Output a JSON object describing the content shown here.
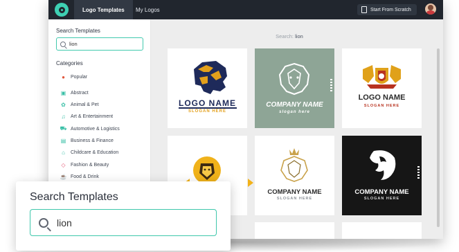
{
  "topbar": {
    "tabs": [
      {
        "label": "Logo Templates",
        "active": true
      },
      {
        "label": "My Logos",
        "active": false
      }
    ],
    "start_button": "Start From Scratch"
  },
  "sidebar": {
    "search_title": "Search Templates",
    "search_value": "lion",
    "categories_title": "Categories",
    "categories": [
      {
        "label": "Popular",
        "icon": "star-icon"
      },
      {
        "label": "Abstract",
        "icon": "abstract-icon"
      },
      {
        "label": "Animal & Pet",
        "icon": "paw-icon"
      },
      {
        "label": "Art & Entertainment",
        "icon": "music-icon"
      },
      {
        "label": "Automotive & Logistics",
        "icon": "car-icon"
      },
      {
        "label": "Business & Finance",
        "icon": "briefcase-icon"
      },
      {
        "label": "Childcare & Education",
        "icon": "graduation-icon"
      },
      {
        "label": "Fashion & Beauty",
        "icon": "diamond-icon"
      },
      {
        "label": "Food & Drink",
        "icon": "food-icon"
      }
    ]
  },
  "main": {
    "search_prefix": "Search:",
    "search_term": "lion",
    "cards": [
      {
        "name": "LOGO NAME",
        "slogan": "SLOGAN HERE"
      },
      {
        "name": "COMPANY NAME",
        "slogan": "slogan here"
      },
      {
        "name": "LOGO NAME",
        "slogan": "SLOGAN HERE"
      },
      {
        "name": "",
        "slogan": ""
      },
      {
        "name": "COMPANY NAME",
        "slogan": "SLOGAN HERE"
      },
      {
        "name": "COMPANY NAME",
        "slogan": "SLOGAN HERE"
      }
    ]
  },
  "callout": {
    "title": "Search Templates",
    "search_value": "lion"
  },
  "colors": {
    "accent": "#3ec7ab",
    "topbar": "#21262e",
    "navy": "#1e2a5a",
    "gold": "#e5a21b"
  }
}
